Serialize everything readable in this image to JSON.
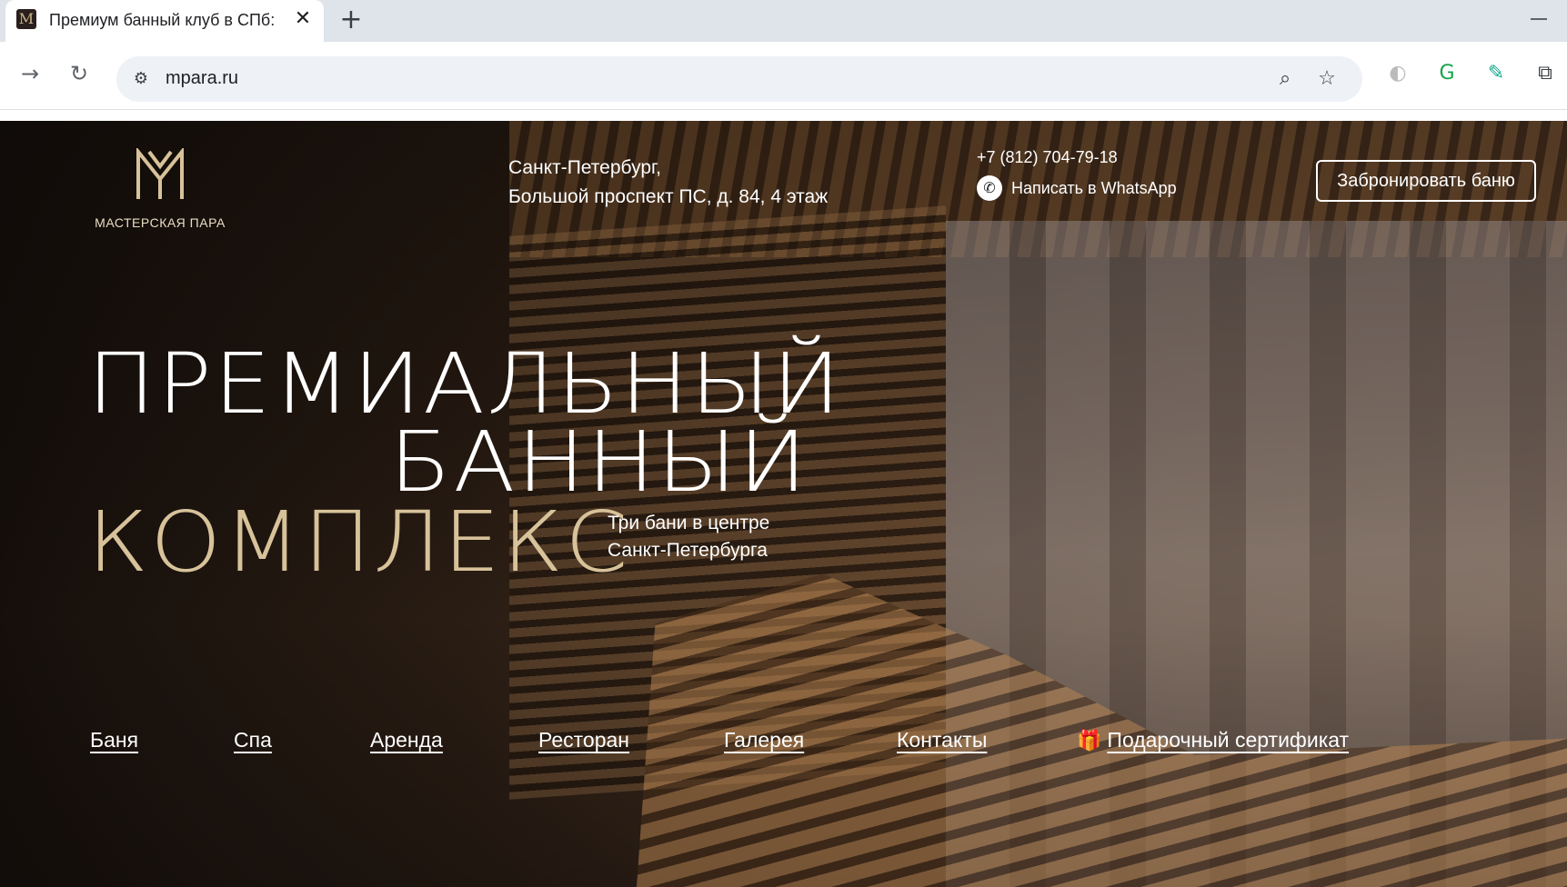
{
  "browser": {
    "tab_title": "Премиум банный клуб в СПб:",
    "favicon_letter": "M",
    "close_glyph": "✕",
    "new_tab_glyph": "+",
    "url": "mpara.ru",
    "icons": [
      "back-icon",
      "reload-icon",
      "site-info-icon",
      "zoom-icon",
      "star-icon",
      "extension-icons"
    ]
  },
  "header": {
    "logo_text": "МАСТЕРСКАЯ ПАРА",
    "address_line1": "Санкт-Петербург,",
    "address_line2": "Большой проспект ПС, д. 84, 4 этаж",
    "phone": "+7 (812) 704-79-18",
    "whatsapp_label": "Написать в WhatsApp",
    "book_label": "Забронировать баню"
  },
  "hero": {
    "title_line1": "ПРЕМИАЛЬНЫЙ",
    "title_line2": "БАННЫЙ",
    "title_line3": "КОМПЛЕКС",
    "subtitle_line1": "Три бани в центре",
    "subtitle_line2": "Санкт-Петербурга"
  },
  "menu": {
    "items": [
      "Баня",
      "Спа",
      "Аренда",
      "Ресторан",
      "Галерея",
      "Контакты"
    ],
    "gift": "Подарочный сертификат"
  },
  "colors": {
    "accent_gold": "#d7c29a",
    "dark": "#1a120c"
  }
}
